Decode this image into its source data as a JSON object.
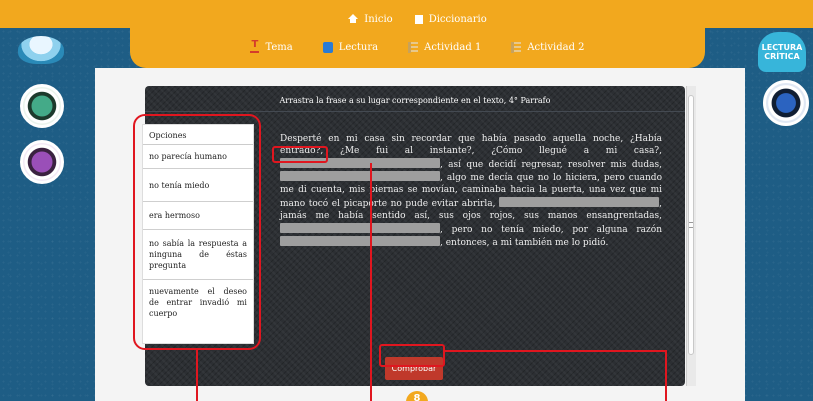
{
  "nav": {
    "home_label": "Inicio",
    "dictionary_label": "Diccionario",
    "tabs": [
      {
        "label": "Tema",
        "icon": "tema-icon"
      },
      {
        "label": "Lectura",
        "icon": "reading-icon"
      },
      {
        "label": "Actividad 1",
        "icon": "activity-icon"
      },
      {
        "label": "Actividad 2",
        "icon": "activity-icon"
      }
    ]
  },
  "side_badge": "LECTURA CRÍTICA",
  "activity": {
    "instruction": "Arrastra la frase a su lugar correspondiente en el texto, 4° Parrafo",
    "options_header": "Opciones",
    "options": [
      "no parecía humano",
      "no tenía miedo",
      "era hermoso",
      "no sabía la respuesta a ninguna de éstas pregunta",
      "nuevamente el deseo de entrar invadió mi cuerpo"
    ],
    "passage": {
      "p1": "Desperté en mi casa sin recordar que había pasado aquella noche, ¿Había entrado?, ¿Me fui al instante?, ¿Cómo llegué a mi casa?,",
      "p2": ", así que decidí regresar, resolver mis dudas,",
      "p3": ", algo me decía que no lo hiciera, pero cuando me di cuenta, mis piernas se movían, caminaba hacia la puerta, una vez que mi mano tocó el picaporte no pude evitar abrirla,",
      "p4": ", jamás me había sentido así, sus ojos rojos, sus manos ensangrentadas,",
      "p5": ", pero no tenía miedo, por alguna razón",
      "p6": ", entonces, a mi también me lo pidió."
    },
    "check_button": "Comprobar",
    "info_badge": "8"
  },
  "colors": {
    "accent_orange": "#f2a81e",
    "background_blue": "#1e5d85",
    "button_red": "#c0392b",
    "annotation_red": "#e0161f"
  }
}
